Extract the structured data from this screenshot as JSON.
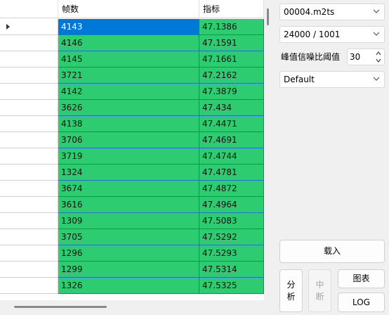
{
  "grid": {
    "columns": [
      "",
      "帧数",
      "指标"
    ],
    "selected_row": 0,
    "rows": [
      {
        "frame": "4143",
        "metric": "47.1386"
      },
      {
        "frame": "4146",
        "metric": "47.1591"
      },
      {
        "frame": "4145",
        "metric": "47.1661"
      },
      {
        "frame": "3721",
        "metric": "47.2162"
      },
      {
        "frame": "4142",
        "metric": "47.3879"
      },
      {
        "frame": "3626",
        "metric": "47.434"
      },
      {
        "frame": "4138",
        "metric": "47.4471"
      },
      {
        "frame": "3706",
        "metric": "47.4691"
      },
      {
        "frame": "3719",
        "metric": "47.4744"
      },
      {
        "frame": "1324",
        "metric": "47.4781"
      },
      {
        "frame": "3674",
        "metric": "47.4872"
      },
      {
        "frame": "3616",
        "metric": "47.4964"
      },
      {
        "frame": "1309",
        "metric": "47.5083"
      },
      {
        "frame": "3705",
        "metric": "47.5292"
      },
      {
        "frame": "1296",
        "metric": "47.5293"
      },
      {
        "frame": "1299",
        "metric": "47.5314"
      },
      {
        "frame": "1326",
        "metric": "47.5325"
      }
    ]
  },
  "panel": {
    "file_select": "00004.m2ts",
    "framerate_select": "24000 / 1001",
    "threshold_label": "峰值信噪比阈值",
    "threshold_value": "30",
    "preset_select": "Default",
    "load_button": "载入",
    "analyze_button": "分析",
    "abort_button": "中断",
    "chart_button": "图表",
    "log_button": "LOG"
  },
  "colors": {
    "cell_green": "#2ecc71",
    "grid_line_blue": "#1e72c8",
    "selection_blue": "#0078d7"
  }
}
